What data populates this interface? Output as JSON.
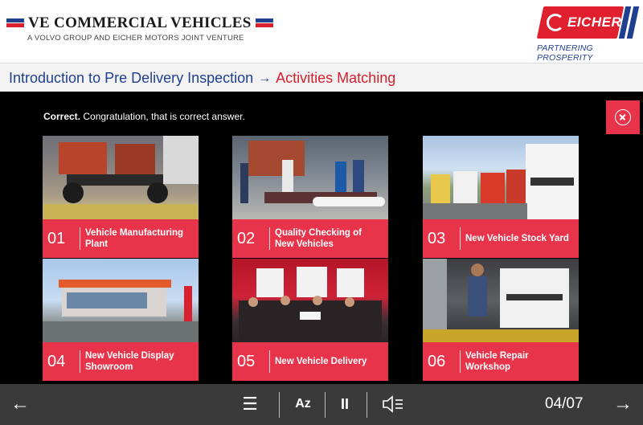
{
  "header": {
    "brand_title": "VE COMMERCIAL VEHICLES",
    "brand_subtitle": "A VOLVO GROUP AND EICHER MOTORS JOINT VENTURE",
    "logo_text": "EICHER",
    "tagline": "PARTNERING PROSPERITY"
  },
  "breadcrumb": {
    "course": "Introduction to Pre Delivery Inspection",
    "arrow": "→",
    "current": "Activities Matching"
  },
  "feedback": {
    "strong": "Correct.",
    "message": " Congratulation, that is correct answer."
  },
  "cards": [
    {
      "num": "01",
      "label": "Vehicle Manufacturing Plant"
    },
    {
      "num": "02",
      "label": "Quality Checking of New Vehicles"
    },
    {
      "num": "03",
      "label": "New Vehicle Stock Yard"
    },
    {
      "num": "04",
      "label": "New Vehicle Display Showroom"
    },
    {
      "num": "05",
      "label": "New Vehicle Delivery"
    },
    {
      "num": "06",
      "label": "Vehicle Repair Workshop"
    }
  ],
  "nav": {
    "prev": "←",
    "menu": "☰",
    "az": "Az",
    "pause": "II",
    "next": "→",
    "page": "04/07"
  },
  "colors": {
    "accent_red": "#e8344a",
    "brand_blue": "#1f3f8f",
    "nav_bg": "#3a3a3a",
    "stage_bg": "#000000"
  }
}
